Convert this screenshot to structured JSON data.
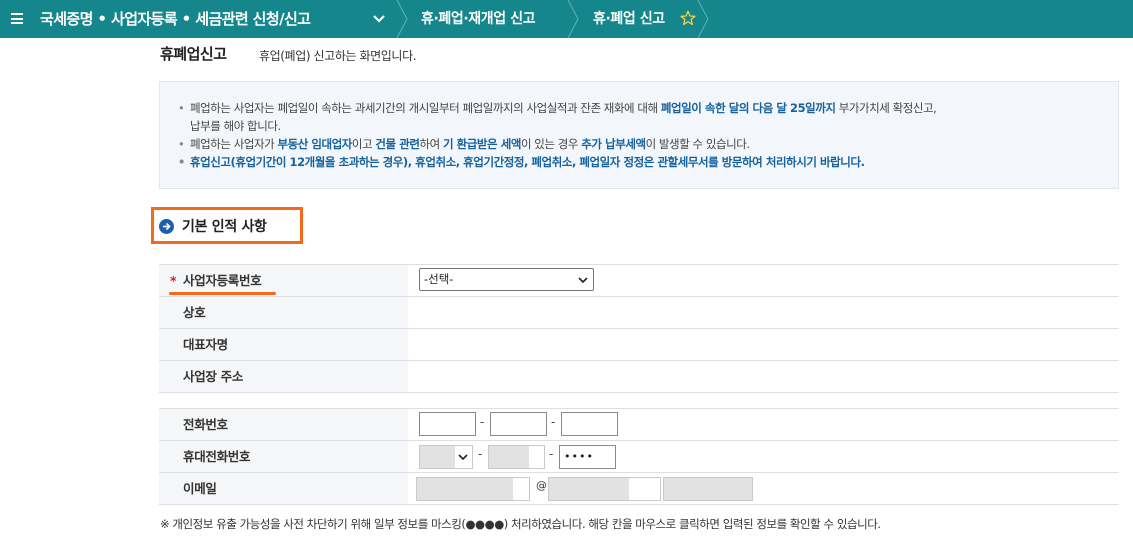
{
  "topbar": {
    "menu_icon": "hamburger-menu-icon",
    "nav1": "국세증명 • 사업자등록 • 세금관련 신청/신고",
    "nav2": "휴·폐업·재개업 신고",
    "nav3": "휴·폐업 신고",
    "favorite_icon": "star-outline-icon",
    "bar_color": "#14868c"
  },
  "page": {
    "title": "휴폐업신고",
    "description": "휴업(폐업) 신고하는 화면입니다."
  },
  "notice": {
    "line1_a": "폐업하는 사업자는 폐업일이 속하는 과세기간의 개시일부터 폐업일까지의 사업실적과 잔존 재화에 대해 ",
    "line1_b": "폐업일이 속한 달의 다음 달 25일까지",
    "line1_c": " 부가가치세 확정신고,",
    "line1_d": "납부를 해야 합니다.",
    "line2_a": "폐업하는 사업자가 ",
    "line2_b": "부동산 임대업자",
    "line2_c": "이고 ",
    "line2_d": "건물 관련",
    "line2_e": "하여 ",
    "line2_f": "기 환급받은 세액",
    "line2_g": "이 있는 경우 ",
    "line2_h": "추가 납부세액",
    "line2_i": "이 발생할 수 있습니다.",
    "line3": "휴업신고(휴업기간이 12개월을 초과하는 경우), 휴업취소, 휴업기간정정, 폐업취소, 폐업일자 정정은 관할세무서를 방문하여 처리하시기 바랍니다."
  },
  "section": {
    "title": "기본 인적 사항",
    "icon": "arrow-right-circle-icon",
    "highlight_color": "#f26b1d"
  },
  "form": {
    "required_mark": "*",
    "biz_reg_no": {
      "label": "사업자등록번호",
      "selected": "-선택-"
    },
    "company_name": {
      "label": "상호"
    },
    "representative": {
      "label": "대표자명"
    },
    "address": {
      "label": "사업장 주소"
    },
    "phone": {
      "label": "전화번호",
      "separator": "-"
    },
    "mobile": {
      "label": "휴대전화번호",
      "separator": "-",
      "last_value": "••••"
    },
    "email": {
      "label": "이메일",
      "at": "@"
    }
  },
  "footnote": "※ 개인정보 유출 가능성을 사전 차단하기 위해 일부 정보를 마스킹(●●●●) 처리하였습니다. 해당 칸을 마우스로 클릭하면 입력된 정보를 확인할 수 있습니다."
}
